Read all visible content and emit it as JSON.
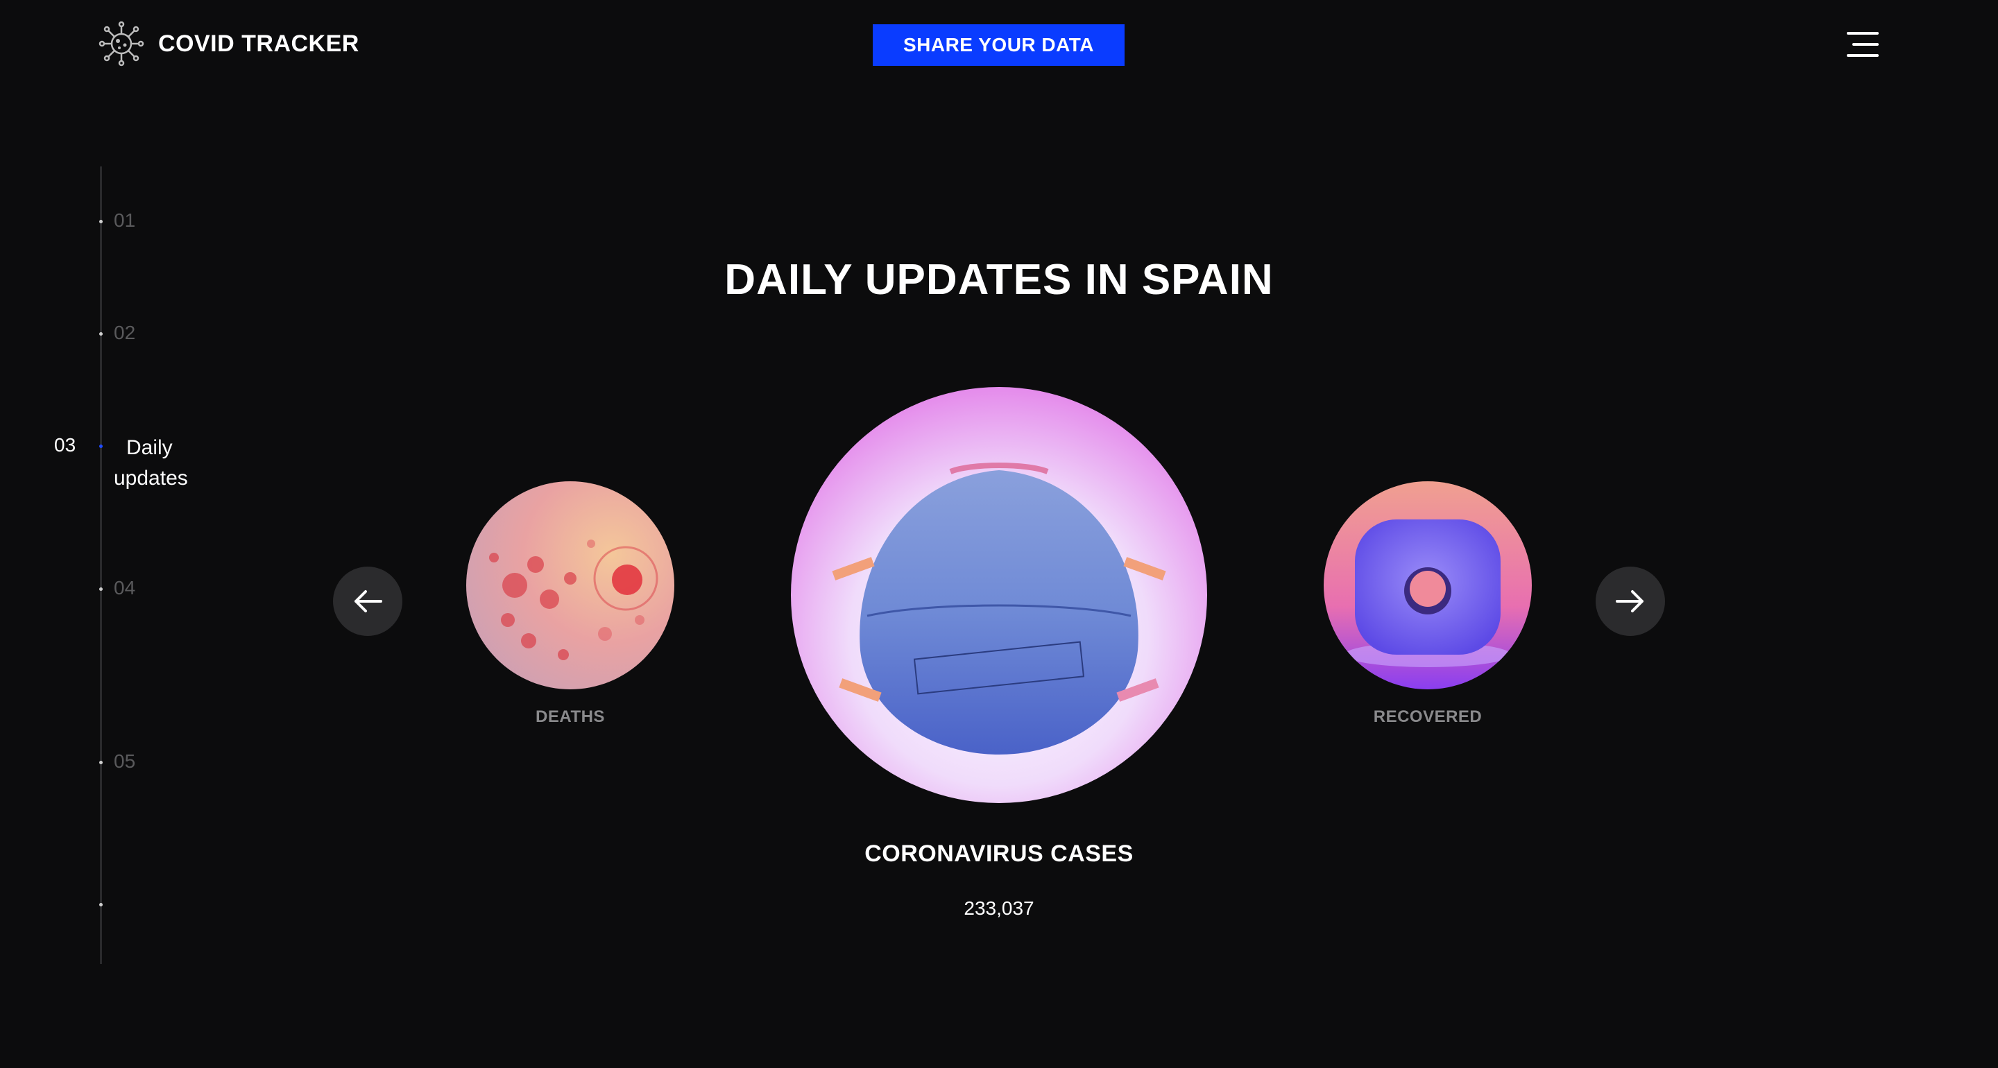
{
  "header": {
    "brand": "COVID TRACKER",
    "share_button": "SHARE YOUR DATA",
    "logo_icon": "virus-icon",
    "menu_icon": "hamburger-menu-icon"
  },
  "sidenav": {
    "items": [
      {
        "num": "01"
      },
      {
        "num": "02"
      },
      {
        "num": "03",
        "label_line1": "Daily",
        "label_line2": "updates",
        "active": true
      },
      {
        "num": "04"
      },
      {
        "num": "05"
      }
    ]
  },
  "main": {
    "title": "DAILY UPDATES IN SPAIN",
    "left_card": {
      "label": "DEATHS",
      "image": "virus-cells-image"
    },
    "center_card": {
      "label": "CORONAVIRUS CASES",
      "value": "233,037",
      "image": "face-mask-image"
    },
    "right_card": {
      "label": "RECOVERED",
      "image": "toilet-paper-roll-image"
    },
    "prev_icon": "arrow-left-icon",
    "next_icon": "arrow-right-icon"
  },
  "colors": {
    "background": "#0c0c0d",
    "accent": "#0a3cff",
    "arrow_bg": "#2b2b2d",
    "muted_text": "#8a8a8c"
  }
}
